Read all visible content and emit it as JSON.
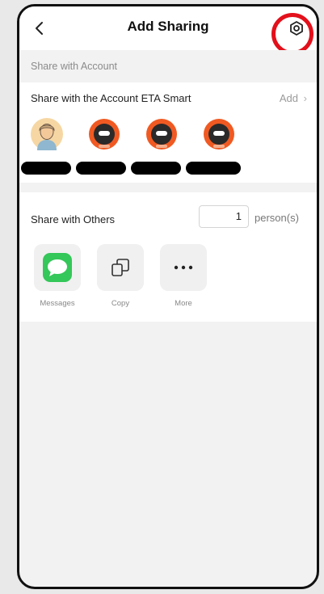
{
  "header": {
    "title": "Add Sharing",
    "back_icon": "chevron-left-icon",
    "settings_icon": "hexagon-gear-icon"
  },
  "share_account": {
    "section_label": "Share with Account",
    "row_title": "Share with the Account ETA Smart",
    "add_label": "Add",
    "add_chevron": "›",
    "members": [
      {
        "avatar": "user-portrait-icon"
      },
      {
        "avatar": "robot-avatar-icon"
      },
      {
        "avatar": "robot-avatar-icon"
      },
      {
        "avatar": "robot-avatar-icon"
      }
    ]
  },
  "share_others": {
    "row_title": "Share with Others",
    "count_value": "1",
    "count_unit": "person(s)",
    "apps": [
      {
        "label": "Messages",
        "icon": "messages-icon"
      },
      {
        "label": "Copy",
        "icon": "copy-icon"
      },
      {
        "label": "More",
        "icon": "more-dots-icon"
      }
    ]
  },
  "colors": {
    "highlight": "#e3101b",
    "robot_orange": "#f05a22",
    "messages_green": "#34c759"
  }
}
